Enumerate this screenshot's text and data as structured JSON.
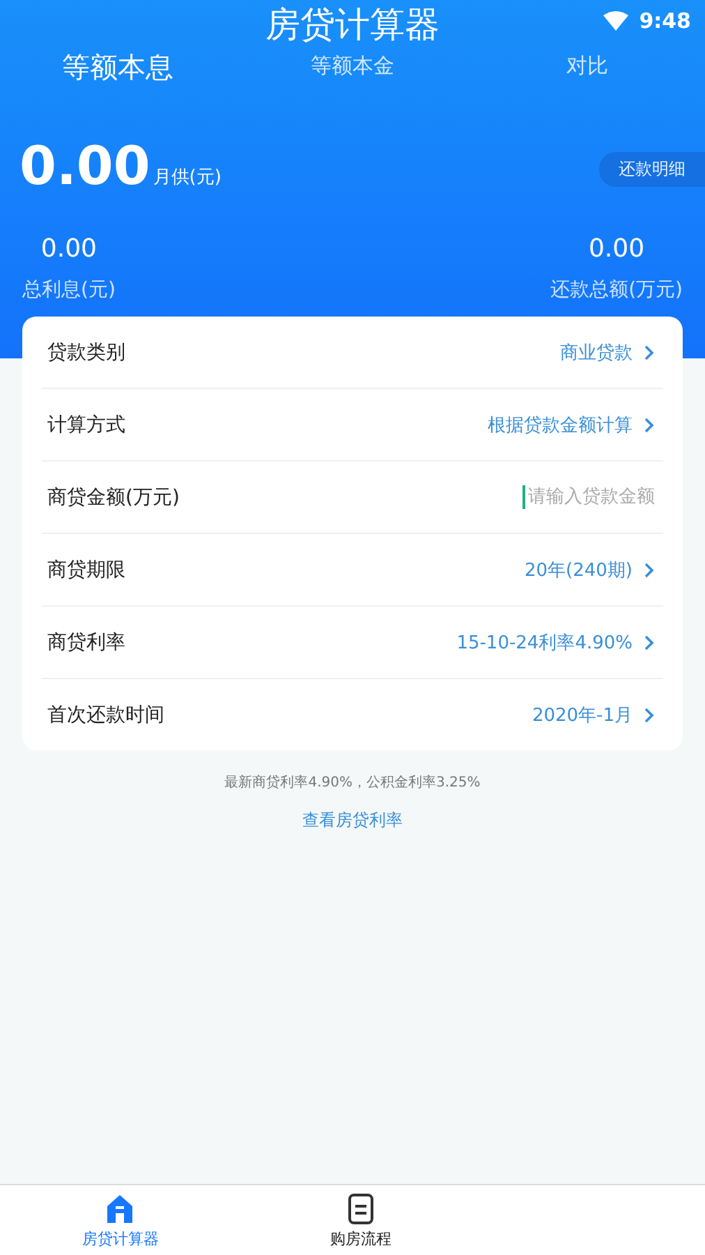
{
  "status_bar": {
    "time": "9:48"
  },
  "title": "房贷计算器",
  "tabs": [
    {
      "label": "等额本息",
      "selected": true
    },
    {
      "label": "等额本金",
      "selected": false
    },
    {
      "label": "对比",
      "selected": false
    }
  ],
  "summary": {
    "monthly_value": "0.00",
    "monthly_label": "月供(元)",
    "detail_button": "还款明细",
    "interest_value": "0.00",
    "interest_label": "总利息(元)",
    "total_value": "0.00",
    "total_label": "还款总额(万元)"
  },
  "form": [
    {
      "kind": "select",
      "label": "贷款类别",
      "value": "商业贷款"
    },
    {
      "kind": "select",
      "label": "计算方式",
      "value": "根据贷款金额计算"
    },
    {
      "kind": "input",
      "label": "商贷金额(万元)",
      "placeholder": "请输入贷款金额"
    },
    {
      "kind": "select",
      "label": "商贷期限",
      "value": "20年(240期)"
    },
    {
      "kind": "select",
      "label": "商贷利率",
      "value": "15-10-24利率4.90%"
    },
    {
      "kind": "select",
      "label": "首次还款时间",
      "value": "2020年-1月"
    }
  ],
  "rate_note": "最新商贷利率4.90%，公积金利率3.25%",
  "rate_link": "查看房贷利率",
  "bottom_nav": [
    {
      "label": "房贷计算器",
      "selected": true
    },
    {
      "label": "购房流程",
      "selected": false
    }
  ]
}
